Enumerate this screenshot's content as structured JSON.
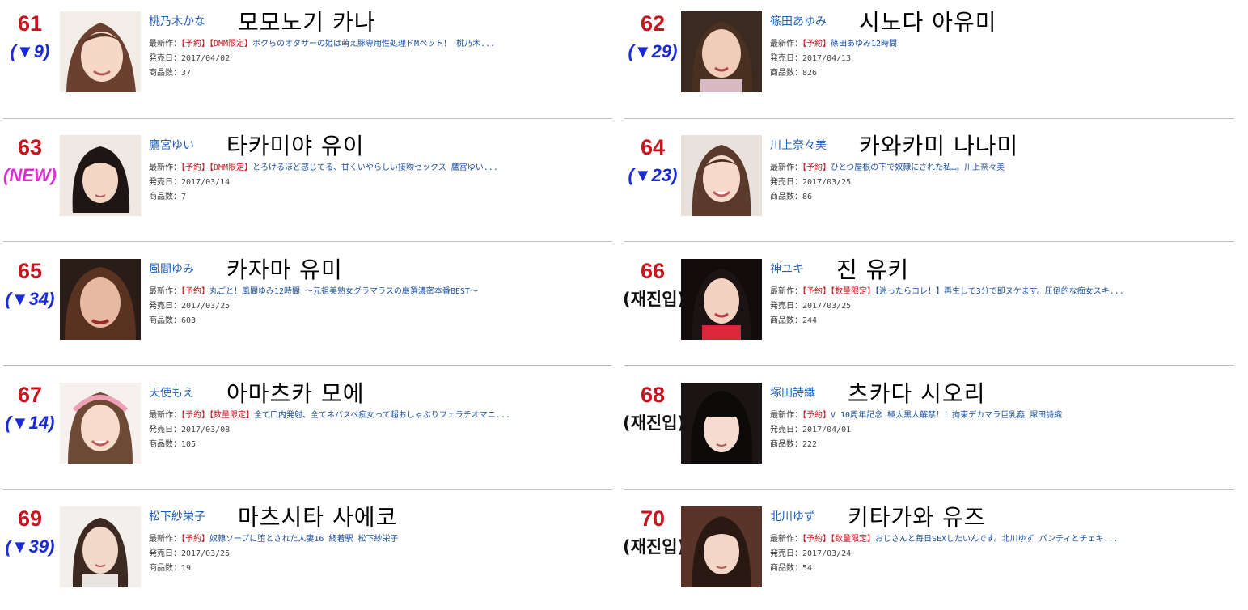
{
  "labels": {
    "latest": "最新作：",
    "release": "発売日：",
    "count": "商品数："
  },
  "colors": {
    "rank": "#c8141e",
    "movement": "#1a2ad6",
    "new": "#e02ad8",
    "jp_name": "#1f5fb4"
  },
  "entries": [
    {
      "rank": "61",
      "movement": "(▼9)",
      "jp_name": "桃乃木かな",
      "kr_name": "모모노기 카나",
      "tags": "【予約】【DMM限定】",
      "work": "ボクらのオタサーの姫は萌え豚専用性処理ドMペット！ 桃乃木...",
      "release_date": "2017/04/02",
      "product_count": "37"
    },
    {
      "rank": "62",
      "movement": "(▼29)",
      "jp_name": "篠田あゆみ",
      "kr_name": "시노다 아유미",
      "tags": "【予約】",
      "work": "篠田あゆみ12時間",
      "release_date": "2017/04/13",
      "product_count": "826"
    },
    {
      "rank": "63",
      "movement": "(NEW)",
      "jp_name": "鷹宮ゆい",
      "kr_name": "타카미야 유이",
      "tags": "【予約】【DMM限定】",
      "work": "とろけるほど感じてる、甘くいやらしい接吻セックス 鷹宮ゆい...",
      "release_date": "2017/03/14",
      "product_count": "7"
    },
    {
      "rank": "64",
      "movement": "(▼23)",
      "jp_name": "川上奈々美",
      "kr_name": "카와카미 나나미",
      "tags": "【予約】",
      "work": "ひとつ屋根の下で奴隷にされた私…。川上奈々美",
      "release_date": "2017/03/25",
      "product_count": "86"
    },
    {
      "rank": "65",
      "movement": "(▼34)",
      "jp_name": "風間ゆみ",
      "kr_name": "카자마 유미",
      "tags": "【予約】",
      "work": "丸ごと！風間ゆみ12時間 ～元祖美熟女グラマラスの厳選濃密本番BEST～",
      "release_date": "2017/03/25",
      "product_count": "603"
    },
    {
      "rank": "66",
      "movement": "(재진입)",
      "jp_name": "神ユキ",
      "kr_name": "진 유키",
      "tags": "【予約】【数量限定】",
      "work": "【迷ったらコレ！】再生して3分で即ヌケます。圧倒的な痴女スキ...",
      "release_date": "2017/03/25",
      "product_count": "244"
    },
    {
      "rank": "67",
      "movement": "(▼14)",
      "jp_name": "天使もえ",
      "kr_name": "아마츠카 모에",
      "tags": "【予約】【数量限定】",
      "work": "全て口内発射、全てネバスペ痴女って超おしゃぶりフェラチオマニ...",
      "release_date": "2017/03/08",
      "product_count": "105"
    },
    {
      "rank": "68",
      "movement": "(재진입)",
      "jp_name": "塚田詩織",
      "kr_name": "츠카다 시오리",
      "tags": "【予約】",
      "work": "V 10周年記念 極太黒人解禁！！拘束デカマラ巨乳姦 塚田詩織",
      "release_date": "2017/04/01",
      "product_count": "222"
    },
    {
      "rank": "69",
      "movement": "(▼39)",
      "jp_name": "松下紗栄子",
      "kr_name": "마츠시타 사에코",
      "tags": "【予約】",
      "work": "奴隷ソープに堕とされた人妻16 終着駅 松下紗栄子",
      "release_date": "2017/03/25",
      "product_count": "19"
    },
    {
      "rank": "70",
      "movement": "(재진입)",
      "jp_name": "北川ゆず",
      "kr_name": "키타가와 유즈",
      "tags": "【予約】【数量限定】",
      "work": "おじさんと毎日SEXしたいんです。北川ゆず パンティとチェキ...",
      "release_date": "2017/03/24",
      "product_count": "54"
    }
  ]
}
